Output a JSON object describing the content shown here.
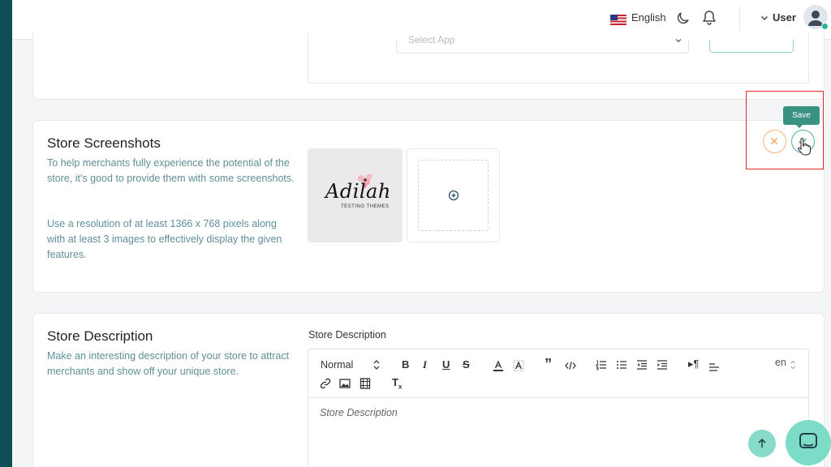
{
  "header": {
    "language_label": "English",
    "user_label": "User"
  },
  "app_section": {
    "select_placeholder": "Select App"
  },
  "screenshots_section": {
    "title": "Store Screenshots",
    "description_1": "To help merchants fully experience the potential of the store, it's good to provide them with some screenshots.",
    "description_2": "Use a resolution of at least 1366 x 768 pixels along with at least 3 images to effectively display the given features.",
    "thumbnail_logo_text": "Adilah",
    "thumbnail_logo_subtitle": "TESTING THEMES"
  },
  "actions": {
    "save_tooltip": "Save"
  },
  "description_section": {
    "title": "Store Description",
    "description": "Make an interesting description of your store to attract merchants and show off your unique store.",
    "field_label": "Store Description",
    "editor_placeholder": "Store Description",
    "format_select": "Normal",
    "language_select": "en"
  },
  "colors": {
    "sidebar": "#0d4f55",
    "accent": "#3a9283",
    "cancel": "#f5b67a",
    "highlight": "#e02b2b",
    "muted_text": "#5f8f97"
  }
}
